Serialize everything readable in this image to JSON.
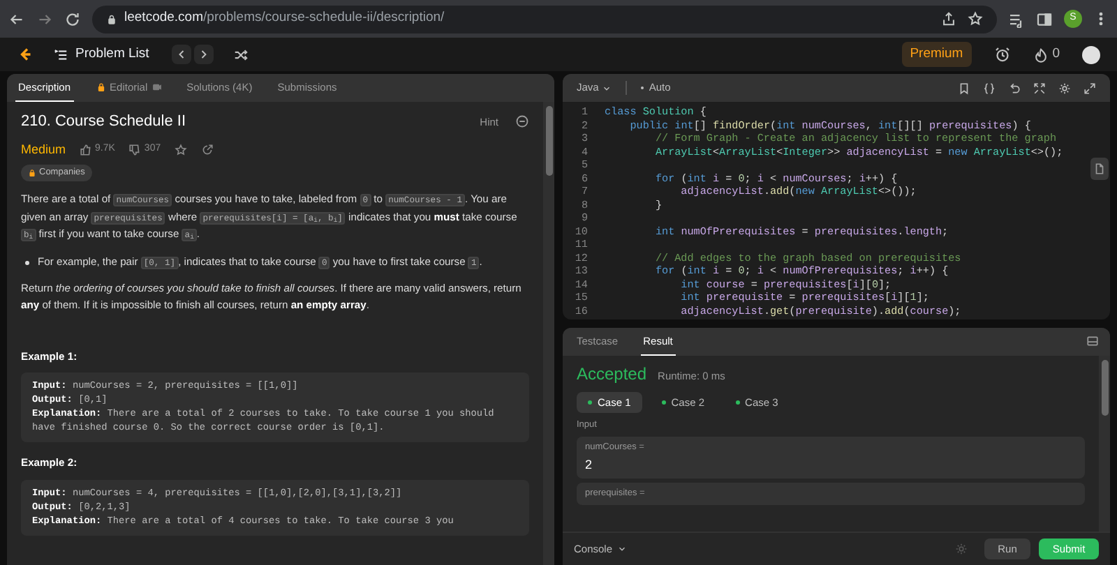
{
  "browser": {
    "url_host": "leetcode.com",
    "url_path": "/problems/course-schedule-ii/description/",
    "profile_letter": "S"
  },
  "header": {
    "problem_list": "Problem List",
    "premium": "Premium",
    "streak": "0"
  },
  "description_tabs": [
    {
      "label": "Description",
      "selected": true,
      "locked": false
    },
    {
      "label": "Editorial",
      "selected": false,
      "locked": true
    },
    {
      "label": "Solutions (4K)",
      "selected": false,
      "locked": false
    },
    {
      "label": "Submissions",
      "selected": false,
      "locked": false
    }
  ],
  "problem": {
    "title": "210. Course Schedule II",
    "hint": "Hint",
    "difficulty": "Medium",
    "likes": "9.7K",
    "dislikes": "307",
    "companies": "Companies",
    "paragraphs": [
      {
        "kind": "para",
        "segments": [
          {
            "text": "There are a total of ",
            "kind": "text"
          },
          {
            "text": "numCourses",
            "kind": "code"
          },
          {
            "text": " courses you have to take, labeled from ",
            "kind": "text"
          },
          {
            "text": "0",
            "kind": "code"
          },
          {
            "text": " to ",
            "kind": "text"
          },
          {
            "text": "numCourses - 1",
            "kind": "code"
          },
          {
            "text": ". You are given an array ",
            "kind": "text"
          },
          {
            "text": "prerequisites",
            "kind": "code"
          },
          {
            "text": " where ",
            "kind": "text"
          },
          {
            "text": "prerequisites[i] = [a$_{i}$, b$_{i}$]",
            "kind": "code"
          },
          {
            "text": " indicates that you ",
            "kind": "text"
          },
          {
            "text": "must",
            "kind": "bold"
          },
          {
            "text": " take course ",
            "kind": "text"
          },
          {
            "text": "b$_{i}$",
            "kind": "code"
          },
          {
            "text": " first if you want to take course ",
            "kind": "text"
          },
          {
            "text": "a$_{i}$",
            "kind": "code"
          },
          {
            "text": ".",
            "kind": "text"
          }
        ]
      },
      {
        "kind": "bullet",
        "segments": [
          {
            "text": "For example, the pair ",
            "kind": "text"
          },
          {
            "text": "[0, 1]",
            "kind": "code"
          },
          {
            "text": ", indicates that to take course ",
            "kind": "text"
          },
          {
            "text": "0",
            "kind": "code"
          },
          {
            "text": " you have to first take course ",
            "kind": "text"
          },
          {
            "text": "1",
            "kind": "code"
          },
          {
            "text": ".",
            "kind": "text"
          }
        ]
      },
      {
        "kind": "para",
        "segments": [
          {
            "text": "Return ",
            "kind": "text"
          },
          {
            "text": "the ordering of courses you should take to finish all courses",
            "kind": "italic"
          },
          {
            "text": ". If there are many valid answers, return ",
            "kind": "text"
          },
          {
            "text": "any",
            "kind": "bold"
          },
          {
            "text": " of them. If it is impossible to finish all courses, return ",
            "kind": "text"
          },
          {
            "text": "an empty array",
            "kind": "bold"
          },
          {
            "text": ".",
            "kind": "text"
          }
        ]
      }
    ],
    "examples": [
      {
        "title": "Example 1:",
        "lines": [
          {
            "label": "Input:",
            "value": "numCourses = 2, prerequisites = [[1,0]]"
          },
          {
            "label": "Output:",
            "value": "[0,1]"
          },
          {
            "label": "Explanation:",
            "value": "There are a total of 2 courses to take. To take course 1 you should have finished course 0. So the correct course order is [0,1]."
          }
        ]
      },
      {
        "title": "Example 2:",
        "lines": [
          {
            "label": "Input:",
            "value": "numCourses = 4, prerequisites = [[1,0],[2,0],[3,1],[3,2]]"
          },
          {
            "label": "Output:",
            "value": "[0,2,1,3]"
          },
          {
            "label": "Explanation:",
            "value": "There are a total of 4 courses to take. To take course 3 you"
          }
        ]
      }
    ]
  },
  "editor": {
    "language": "Java",
    "mode": "Auto",
    "lines": [
      {
        "n": "1",
        "tokens": [
          {
            "text": "class ",
            "kind": "kw"
          },
          {
            "text": "Solution",
            "kind": "type"
          },
          {
            "text": " {",
            "kind": "p"
          }
        ]
      },
      {
        "n": "2",
        "tokens": [
          {
            "text": "    public ",
            "kind": "kw"
          },
          {
            "text": "int",
            "kind": "kw"
          },
          {
            "text": "[] ",
            "kind": "p"
          },
          {
            "text": "findOrder",
            "kind": "fn"
          },
          {
            "text": "(",
            "kind": "p"
          },
          {
            "text": "int ",
            "kind": "kw"
          },
          {
            "text": "numCourses",
            "kind": "var"
          },
          {
            "text": ", ",
            "kind": "p"
          },
          {
            "text": "int",
            "kind": "kw"
          },
          {
            "text": "[][] ",
            "kind": "p"
          },
          {
            "text": "prerequisites",
            "kind": "var"
          },
          {
            "text": ") {",
            "kind": "p"
          }
        ]
      },
      {
        "n": "3",
        "tokens": [
          {
            "text": "        // Form Graph - Create an adjacency list to represent the graph",
            "kind": "cm"
          }
        ]
      },
      {
        "n": "4",
        "tokens": [
          {
            "text": "        ArrayList",
            "kind": "type"
          },
          {
            "text": "<",
            "kind": "p"
          },
          {
            "text": "ArrayList",
            "kind": "type"
          },
          {
            "text": "<",
            "kind": "p"
          },
          {
            "text": "Integer",
            "kind": "type"
          },
          {
            "text": ">> ",
            "kind": "p"
          },
          {
            "text": "adjacencyList",
            "kind": "var"
          },
          {
            "text": " = ",
            "kind": "p"
          },
          {
            "text": "new ",
            "kind": "kw"
          },
          {
            "text": "ArrayList",
            "kind": "type"
          },
          {
            "text": "<>();",
            "kind": "p"
          }
        ]
      },
      {
        "n": "5"
      },
      {
        "n": "6",
        "tokens": [
          {
            "text": "        for ",
            "kind": "kw"
          },
          {
            "text": "(",
            "kind": "p"
          },
          {
            "text": "int ",
            "kind": "kw"
          },
          {
            "text": "i",
            "kind": "var"
          },
          {
            "text": " = ",
            "kind": "p"
          },
          {
            "text": "0",
            "kind": "num"
          },
          {
            "text": "; ",
            "kind": "p"
          },
          {
            "text": "i",
            "kind": "var"
          },
          {
            "text": " < ",
            "kind": "p"
          },
          {
            "text": "numCourses",
            "kind": "var"
          },
          {
            "text": "; ",
            "kind": "p"
          },
          {
            "text": "i",
            "kind": "var"
          },
          {
            "text": "++) {",
            "kind": "p"
          }
        ]
      },
      {
        "n": "7",
        "tokens": [
          {
            "text": "            adjacencyList",
            "kind": "var"
          },
          {
            "text": ".",
            "kind": "p"
          },
          {
            "text": "add",
            "kind": "fn"
          },
          {
            "text": "(",
            "kind": "p"
          },
          {
            "text": "new ",
            "kind": "kw"
          },
          {
            "text": "ArrayList",
            "kind": "type"
          },
          {
            "text": "<>());",
            "kind": "p"
          }
        ]
      },
      {
        "n": "8",
        "tokens": [
          {
            "text": "        }",
            "kind": "p"
          }
        ]
      },
      {
        "n": "9"
      },
      {
        "n": "10",
        "tokens": [
          {
            "text": "        int ",
            "kind": "kw"
          },
          {
            "text": "numOfPrerequisites",
            "kind": "var"
          },
          {
            "text": " = ",
            "kind": "p"
          },
          {
            "text": "prerequisites",
            "kind": "var"
          },
          {
            "text": ".",
            "kind": "p"
          },
          {
            "text": "length",
            "kind": "var"
          },
          {
            "text": ";",
            "kind": "p"
          }
        ]
      },
      {
        "n": "11"
      },
      {
        "n": "12",
        "tokens": [
          {
            "text": "        // Add edges to the graph based on prerequisites",
            "kind": "cm"
          }
        ]
      },
      {
        "n": "13",
        "tokens": [
          {
            "text": "        for ",
            "kind": "kw"
          },
          {
            "text": "(",
            "kind": "p"
          },
          {
            "text": "int ",
            "kind": "kw"
          },
          {
            "text": "i",
            "kind": "var"
          },
          {
            "text": " = ",
            "kind": "p"
          },
          {
            "text": "0",
            "kind": "num"
          },
          {
            "text": "; ",
            "kind": "p"
          },
          {
            "text": "i",
            "kind": "var"
          },
          {
            "text": " < ",
            "kind": "p"
          },
          {
            "text": "numOfPrerequisites",
            "kind": "var"
          },
          {
            "text": "; ",
            "kind": "p"
          },
          {
            "text": "i",
            "kind": "var"
          },
          {
            "text": "++) {",
            "kind": "p"
          }
        ]
      },
      {
        "n": "14",
        "tokens": [
          {
            "text": "            int ",
            "kind": "kw"
          },
          {
            "text": "course",
            "kind": "var"
          },
          {
            "text": " = ",
            "kind": "p"
          },
          {
            "text": "prerequisites",
            "kind": "var"
          },
          {
            "text": "[",
            "kind": "p"
          },
          {
            "text": "i",
            "kind": "var"
          },
          {
            "text": "][",
            "kind": "p"
          },
          {
            "text": "0",
            "kind": "num"
          },
          {
            "text": "];",
            "kind": "p"
          }
        ]
      },
      {
        "n": "15",
        "tokens": [
          {
            "text": "            int ",
            "kind": "kw"
          },
          {
            "text": "prerequisite",
            "kind": "var"
          },
          {
            "text": " = ",
            "kind": "p"
          },
          {
            "text": "prerequisites",
            "kind": "var"
          },
          {
            "text": "[",
            "kind": "p"
          },
          {
            "text": "i",
            "kind": "var"
          },
          {
            "text": "][",
            "kind": "p"
          },
          {
            "text": "1",
            "kind": "num"
          },
          {
            "text": "];",
            "kind": "p"
          }
        ]
      },
      {
        "n": "16",
        "tokens": [
          {
            "text": "            adjacencyList",
            "kind": "var"
          },
          {
            "text": ".",
            "kind": "p"
          },
          {
            "text": "get",
            "kind": "fn"
          },
          {
            "text": "(",
            "kind": "p"
          },
          {
            "text": "prerequisite",
            "kind": "var"
          },
          {
            "text": ").",
            "kind": "p"
          },
          {
            "text": "add",
            "kind": "fn"
          },
          {
            "text": "(",
            "kind": "p"
          },
          {
            "text": "course",
            "kind": "var"
          },
          {
            "text": ");",
            "kind": "p"
          }
        ]
      }
    ]
  },
  "result_tabs": [
    {
      "label": "Testcase",
      "selected": false
    },
    {
      "label": "Result",
      "selected": true
    }
  ],
  "result": {
    "status": "Accepted",
    "runtime": "Runtime: 0 ms",
    "cases": [
      {
        "label": "Case 1",
        "selected": true,
        "color": "#2cbb5d"
      },
      {
        "label": "Case 2",
        "selected": false,
        "color": "#2cbb5d"
      },
      {
        "label": "Case 3",
        "selected": false,
        "color": "#2cbb5d"
      }
    ],
    "input_label": "Input",
    "inputs": [
      {
        "name": "numCourses =",
        "value": "2"
      },
      {
        "name": "prerequisites ="
      }
    ]
  },
  "console": {
    "label": "Console",
    "run": "Run",
    "submit": "Submit"
  }
}
